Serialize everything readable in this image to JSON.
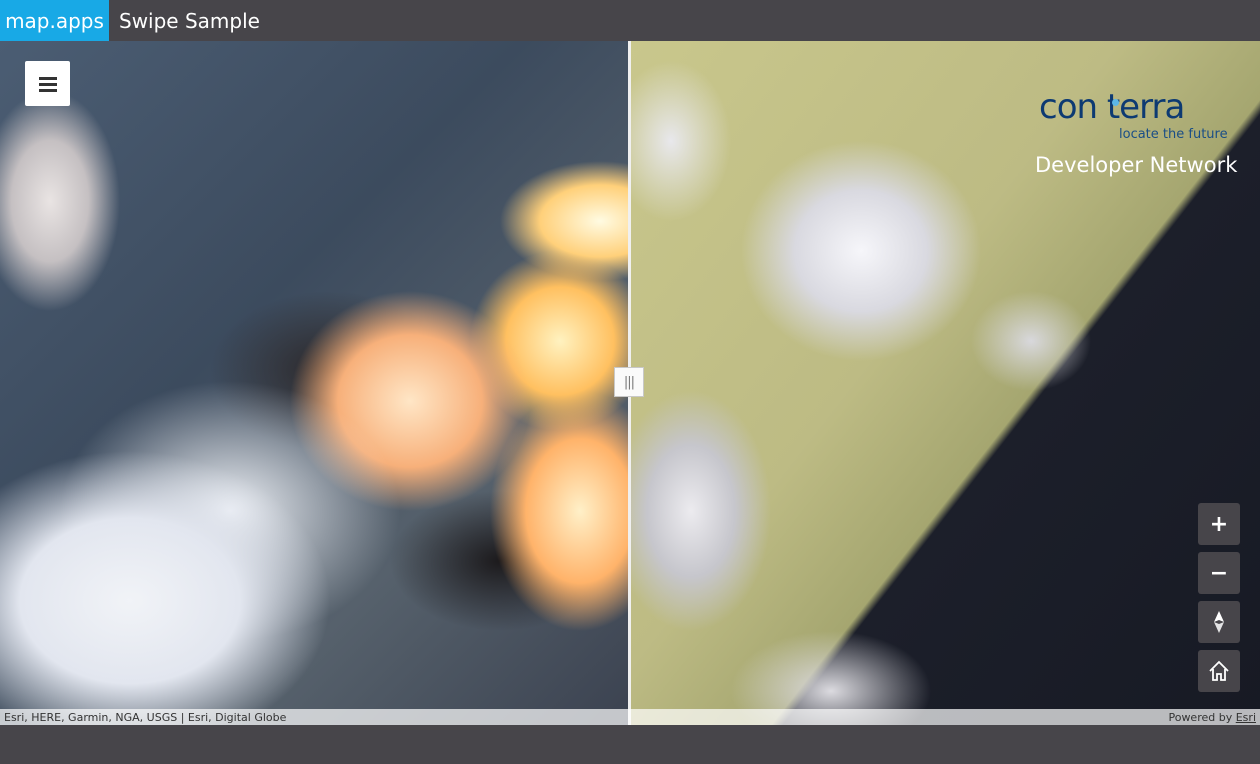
{
  "header": {
    "brand": "map.apps",
    "title": "Swipe Sample"
  },
  "logo": {
    "wordmark": "con terra",
    "tagline": "locate the future",
    "subtitle": "Developer Network"
  },
  "swipe": {
    "handle_label": "|||"
  },
  "controls": {
    "zoom_in_label": "+",
    "zoom_out_label": "−",
    "compass_icon": "compass-icon",
    "home_icon": "home-icon",
    "menu_icon": "hamburger-menu-icon"
  },
  "attribution": {
    "sources": "Esri, HERE, Garmin, NGA, USGS | Esri, Digital Globe",
    "powered_by_prefix": "Powered by ",
    "powered_by_link": "Esri"
  }
}
